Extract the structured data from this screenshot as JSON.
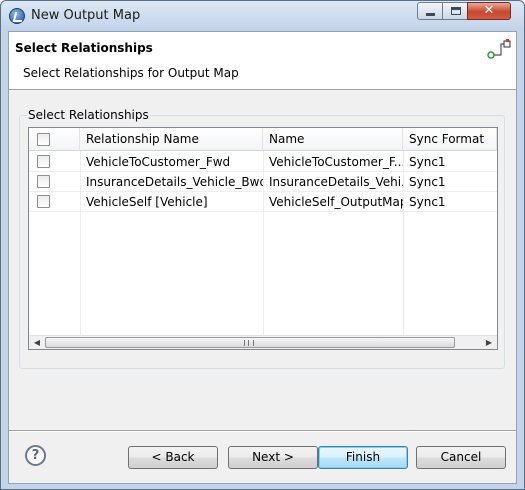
{
  "window": {
    "title": "New Output Map",
    "close_glyph": "✕"
  },
  "header": {
    "title": "Select Relationships",
    "description": "Select Relationships for Output Map"
  },
  "group": {
    "label": "Select Relationships"
  },
  "table": {
    "columns": [
      "Relationship Name",
      "Name",
      "Sync Format"
    ],
    "rows": [
      {
        "checked": false,
        "relationship": "VehicleToCustomer_Fwd",
        "name": "VehicleToCustomer_F...",
        "sync": "Sync1"
      },
      {
        "checked": false,
        "relationship": "InsuranceDetails_Vehicle_Bwd",
        "name": "InsuranceDetails_Vehi...",
        "sync": "Sync1"
      },
      {
        "checked": false,
        "relationship": "VehicleSelf [Vehicle]",
        "name": "VehicleSelf_OutputMap",
        "sync": "Sync1"
      }
    ]
  },
  "scrollbar": {
    "left_arrow": "◀",
    "right_arrow": "▶"
  },
  "footer": {
    "help": "?",
    "back": "< Back",
    "next": "Next >",
    "finish": "Finish",
    "cancel": "Cancel"
  },
  "icons": {
    "app": "app-globe-icon",
    "wizard": "relationship-wizard-icon"
  }
}
